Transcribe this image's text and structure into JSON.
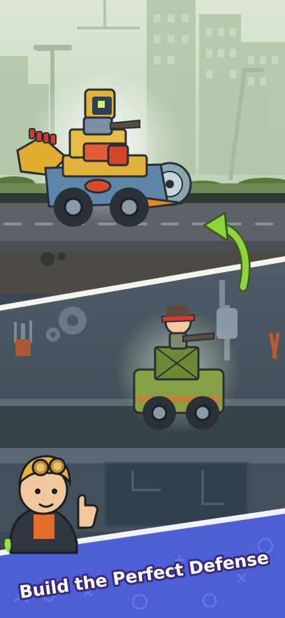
{
  "banner": {
    "words": [
      "Build",
      "the",
      "Perfect",
      "Defense"
    ]
  },
  "colors": {
    "sky": "#c9d9c0",
    "road": "#5b6066",
    "garage": "#4a5963",
    "banner": "#4e5fd6",
    "banner_text_fill": "#ffffff",
    "banner_text_stroke": "#3b2a7c",
    "arrow": "#8ed43a",
    "jeep": "#7f9a3a",
    "truck_yellow": "#e7b43a"
  },
  "icons": {
    "upgrade_arrow": "curved-arrow-icon",
    "gear": "gear-icon",
    "wrench": "wrench-icon",
    "thumbs_up": "thumbs-up-icon"
  }
}
